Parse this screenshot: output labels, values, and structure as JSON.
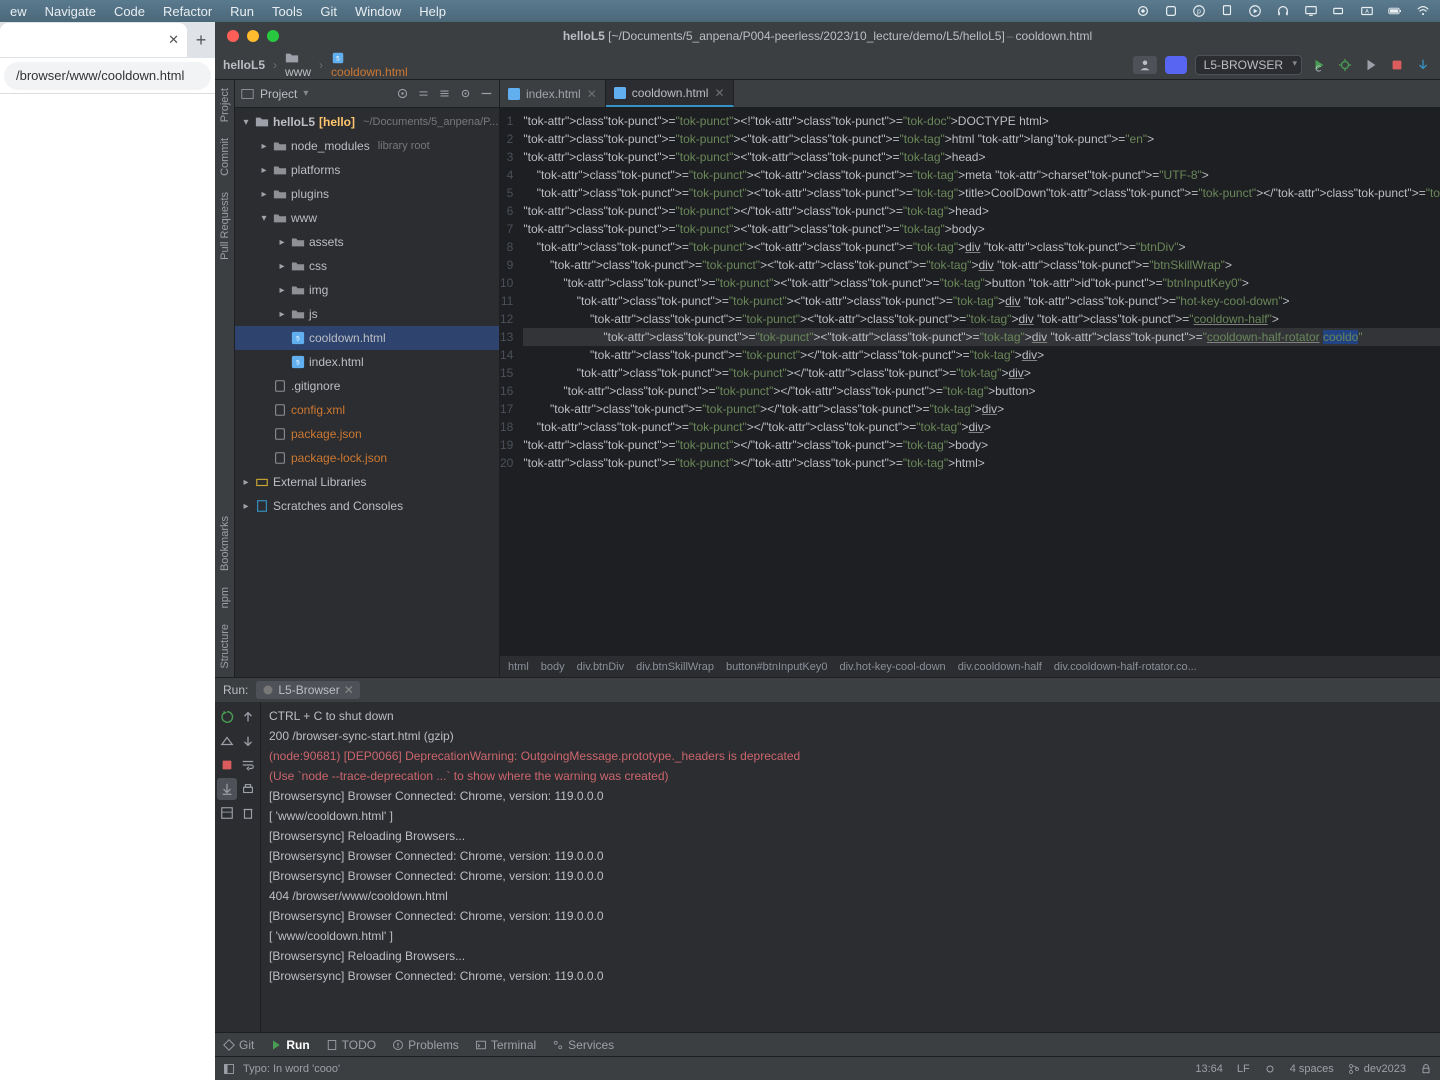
{
  "menubar": {
    "items": [
      "ew",
      "Navigate",
      "Code",
      "Refactor",
      "Run",
      "Tools",
      "Git",
      "Window",
      "Help"
    ]
  },
  "chrome": {
    "url": "/browser/www/cooldown.html"
  },
  "ide": {
    "title": {
      "project": "helloL5",
      "path": "[~/Documents/5_anpena/P004-peerless/2023/10_lecture/demo/L5/helloL5]",
      "file": "cooldown.html"
    },
    "breadcrumbs": {
      "a": "helloL5",
      "b": "www",
      "c": "cooldown.html"
    },
    "runconf": "L5-BROWSER"
  },
  "project": {
    "title": "Project",
    "root": {
      "name": "helloL5",
      "bold": "[hello]",
      "suffix": "~/Documents/5_anpena/P..."
    },
    "items": [
      {
        "indent": 1,
        "icon": "folder",
        "label": "node_modules",
        "sub": "library root",
        "expand": ">"
      },
      {
        "indent": 1,
        "icon": "folder",
        "label": "platforms",
        "expand": ">"
      },
      {
        "indent": 1,
        "icon": "folder",
        "label": "plugins",
        "expand": ">"
      },
      {
        "indent": 1,
        "icon": "folder",
        "label": "www",
        "expand": "v"
      },
      {
        "indent": 2,
        "icon": "folder",
        "label": "assets",
        "expand": ">"
      },
      {
        "indent": 2,
        "icon": "folder",
        "label": "css",
        "expand": ">"
      },
      {
        "indent": 2,
        "icon": "folder",
        "label": "img",
        "expand": ">"
      },
      {
        "indent": 2,
        "icon": "folder",
        "label": "js",
        "expand": ">"
      },
      {
        "indent": 2,
        "icon": "html",
        "label": "cooldown.html",
        "sel": true
      },
      {
        "indent": 2,
        "icon": "html",
        "label": "index.html"
      },
      {
        "indent": 1,
        "icon": "file",
        "label": ".gitignore"
      },
      {
        "indent": 1,
        "icon": "file",
        "label": "config.xml",
        "orange": true
      },
      {
        "indent": 1,
        "icon": "file",
        "label": "package.json",
        "orange": true
      },
      {
        "indent": 1,
        "icon": "file",
        "label": "package-lock.json",
        "orange": true
      }
    ],
    "ext": "External Libraries",
    "scratch": "Scratches and Consoles"
  },
  "tabs": {
    "a": "index.html",
    "b": "cooldown.html"
  },
  "code": {
    "lines": [
      "<!DOCTYPE html>",
      "<html lang=\"en\">",
      "<head>",
      "    <meta charset=\"UTF-8\">",
      "    <title>CoolDown</title>",
      "</head>",
      "<body>",
      "    <div class=\"btnDiv\">",
      "        <div class=\"btnSkillWrap\">",
      "            <button id=\"btnInputKey0\">",
      "                <div class=\"hot-key-cool-down\">",
      "                    <div class=\"cooldown-half\">",
      "                        <div class=\"cooldown-half-rotator cooldo\"",
      "                    </div>",
      "                </div>",
      "            </button>",
      "        </div>",
      "    </div>",
      "</body>",
      "</html>"
    ]
  },
  "breadcrumb_editor": [
    "html",
    "body",
    "div.btnDiv",
    "div.btnSkillWrap",
    "button#btnInputKey0",
    "div.hot-key-cool-down",
    "div.cooldown-half",
    "div.cooldown-half-rotator.co..."
  ],
  "run": {
    "label": "Run:",
    "tab": "L5-Browser",
    "lines": [
      {
        "t": "    CTRL + C to shut down"
      },
      {
        "t": "    200 /browser-sync-start.html (gzip)"
      },
      {
        "t": "(node:90681) [DEP0066] DeprecationWarning: OutgoingMessage.prototype._headers is deprecated",
        "cls": "red"
      },
      {
        "t": "(Use `node --trace-deprecation ...` to show where the warning was created)",
        "cls": "red"
      },
      {
        "t": "[Browsersync] Browser Connected: Chrome, version: 119.0.0.0"
      },
      {
        "t": "[ 'www/cooldown.html' ]"
      },
      {
        "t": "[Browsersync] Reloading Browsers..."
      },
      {
        "t": "[Browsersync] Browser Connected: Chrome, version: 119.0.0.0"
      },
      {
        "t": "[Browsersync] Browser Connected: Chrome, version: 119.0.0.0"
      },
      {
        "t": "    404 /browser/www/cooldown.html"
      },
      {
        "t": "[Browsersync] Browser Connected: Chrome, version: 119.0.0.0"
      },
      {
        "t": "[ 'www/cooldown.html' ]"
      },
      {
        "t": "[Browsersync] Reloading Browsers..."
      },
      {
        "t": "[Browsersync] Browser Connected: Chrome, version: 119.0.0.0"
      }
    ]
  },
  "tooltabs": {
    "git": "Git",
    "run": "Run",
    "todo": "TODO",
    "problems": "Problems",
    "terminal": "Terminal",
    "services": "Services"
  },
  "status": {
    "msg": "Typo: In word 'cooo'",
    "pos": "13:64",
    "lf": "LF",
    "indent": "4 spaces",
    "branch": "dev2023"
  },
  "leftstrip": {
    "project": "Project",
    "commit": "Commit",
    "pr": "Pull Requests",
    "bookmarks": "Bookmarks",
    "npm": "npm",
    "structure": "Structure"
  }
}
